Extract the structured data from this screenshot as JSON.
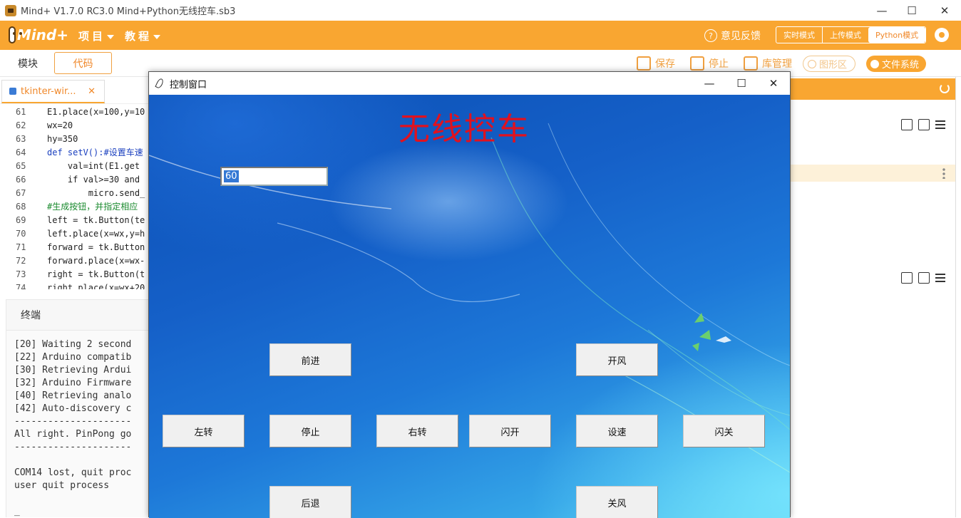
{
  "titlebar": {
    "title": "Mind+ V1.7.0 RC3.0    Mind+Python无线控车.sb3",
    "minimize": "—",
    "maximize": "☐",
    "close": "✕"
  },
  "toolbar": {
    "logo_text": "Mind+",
    "menu_project": "项目",
    "menu_tutorial": "教程",
    "feedback": "意见反馈",
    "modes": [
      "实时模式",
      "上传模式",
      "Python模式"
    ],
    "active_mode": "Python模式",
    "accent_color": "#f9a631"
  },
  "row2": {
    "tab_blocks": "模块",
    "tab_code": "代码",
    "save": "保存",
    "stop": "停止",
    "libs": "库管理",
    "graphics": "图形区",
    "files": "文件系统"
  },
  "editor": {
    "file_tab": "tkinter-wir...",
    "file_close": "✕",
    "lines": [
      {
        "n": "61",
        "t": "E1.place(x=100,y=10",
        "c": "tx"
      },
      {
        "n": "62",
        "t": "wx=20",
        "c": "tx"
      },
      {
        "n": "63",
        "t": "hy=350",
        "c": "tx"
      },
      {
        "n": "64",
        "t": "def setV():#设置车速",
        "c": "tx kw"
      },
      {
        "n": "65",
        "t": "    val=int(E1.get",
        "c": "tx"
      },
      {
        "n": "66",
        "t": "    if val>=30 and",
        "c": "tx"
      },
      {
        "n": "67",
        "t": "        micro.send_",
        "c": "tx"
      },
      {
        "n": "68",
        "t": "#生成按钮，并指定相应",
        "c": "tx cm"
      },
      {
        "n": "69",
        "t": "left = tk.Button(te",
        "c": "tx"
      },
      {
        "n": "70",
        "t": "left.place(x=wx,y=h",
        "c": "tx"
      },
      {
        "n": "71",
        "t": "forward = tk.Button",
        "c": "tx"
      },
      {
        "n": "72",
        "t": "forward.place(x=wx-",
        "c": "tx"
      },
      {
        "n": "73",
        "t": "right = tk.Button(t",
        "c": "tx"
      },
      {
        "n": "74",
        "t": "right.place(x=wx+20",
        "c": "tx"
      }
    ]
  },
  "terminal": {
    "title": "终端",
    "lines": [
      "[20] Waiting 2 second",
      "[22] Arduino compatib",
      "[30] Retrieving Ardui",
      "[32] Arduino Firmware",
      "[40] Retrieving analo",
      "[42] Auto-discovery c",
      "---------------------",
      "All right. PinPong go",
      "---------------------",
      "",
      "COM14 lost, quit proc",
      "user quit process",
      "",
      "_"
    ]
  },
  "tk_window": {
    "title": "控制窗口",
    "minimize": "—",
    "maximize": "☐",
    "close": "✕",
    "heading": "无线控车",
    "speed_value": "60",
    "buttons": {
      "forward": "前进",
      "fan_on": "开风",
      "left": "左转",
      "stop": "停止",
      "right": "右转",
      "flash_on": "闪开",
      "set_speed": "设速",
      "flash_off": "闪关",
      "backward": "后退",
      "fan_off": "关风"
    }
  }
}
